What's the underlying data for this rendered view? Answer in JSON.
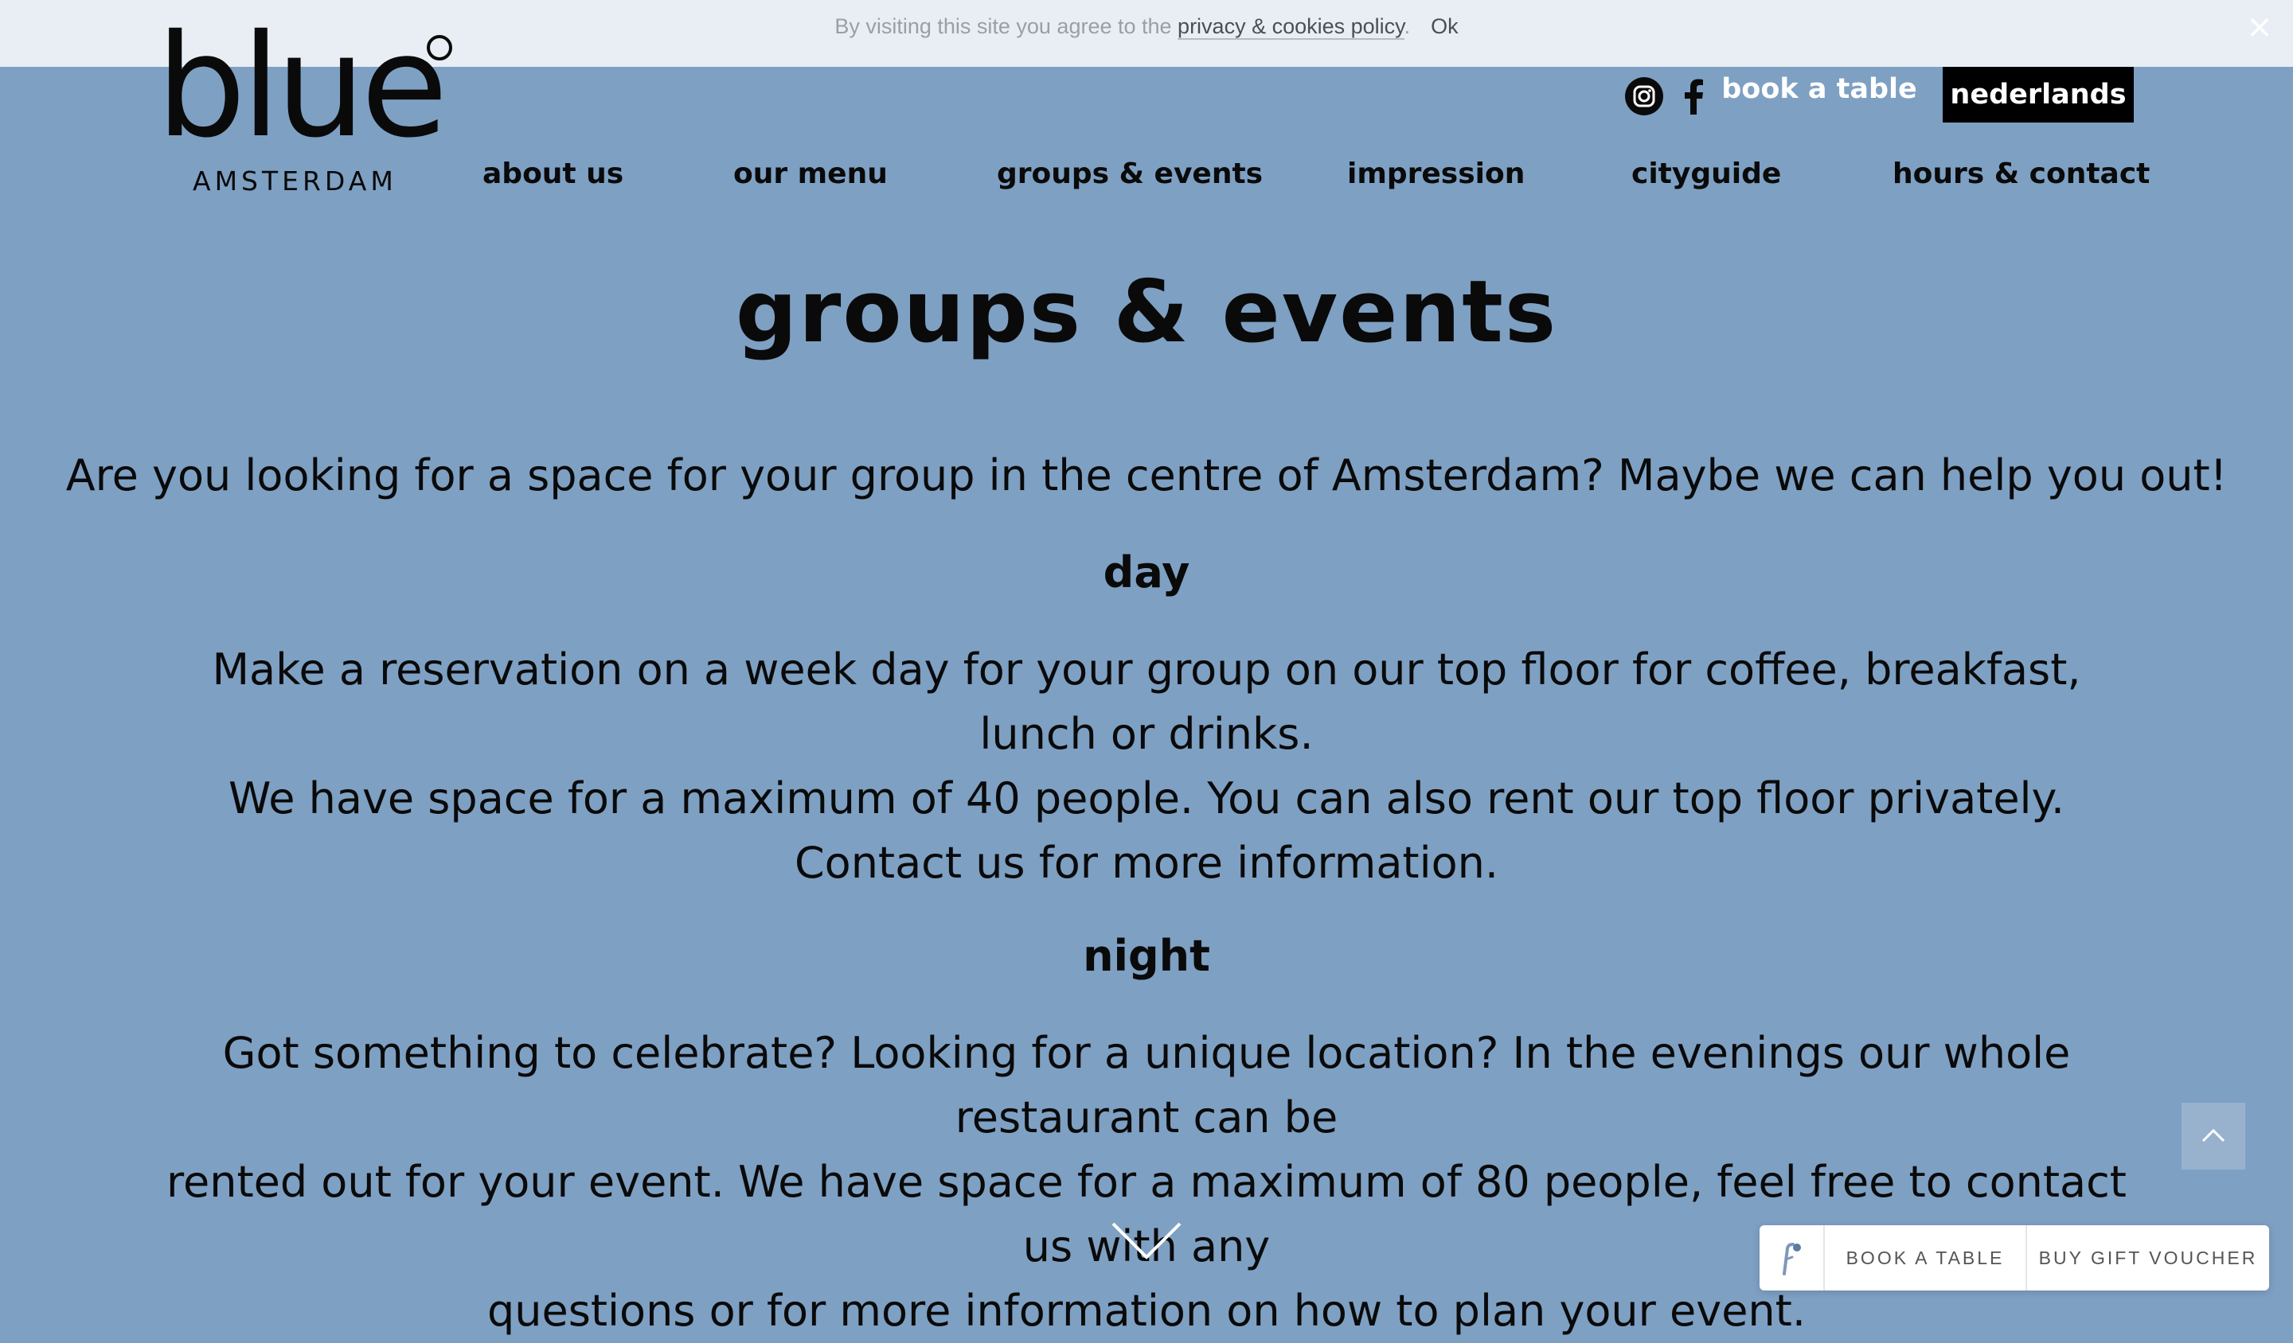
{
  "cookie": {
    "text": "By visiting this site you agree to the ",
    "link": "privacy & cookies policy",
    "period": ".",
    "ok": "Ok",
    "close": "×"
  },
  "logo": {
    "word": "blue",
    "city": "AMSTERDAM"
  },
  "header": {
    "instagram_icon": "instagram-icon",
    "facebook_icon": "facebook-icon",
    "book_link": "book a table",
    "language": "nederlands"
  },
  "nav": {
    "items": [
      {
        "label": "about us"
      },
      {
        "label": "our menu"
      },
      {
        "label": "groups & events"
      },
      {
        "label": "impression"
      },
      {
        "label": "cityguide"
      },
      {
        "label": "hours & contact"
      }
    ]
  },
  "main": {
    "title": "groups & events",
    "intro": "Are you looking for a space for your group in the centre of Amsterdam? Maybe we can help you out!",
    "day": {
      "heading": "day",
      "lines": [
        "Make a reservation on a week day for your group on our top floor for coffee, breakfast, lunch or drinks.",
        "We have space for a maximum of 40 people. You can also rent our top floor privately.",
        "Contact us for more information."
      ]
    },
    "night": {
      "heading": "night",
      "lines": [
        "Got something to celebrate? Looking for a unique location? In the evenings our whole restaurant can be",
        "rented out for your event. We have space for a maximum of 80 people, feel free to contact us with any",
        "questions or for more information on how to plan your event."
      ]
    }
  },
  "widget": {
    "book": "BOOK A TABLE",
    "voucher": "BUY GIFT VOUCHER"
  },
  "colors": {
    "background": "#7ea0c3",
    "cookie_bar": "#e9eef4",
    "text": "#0a0a0a",
    "language_button": "#000000"
  }
}
